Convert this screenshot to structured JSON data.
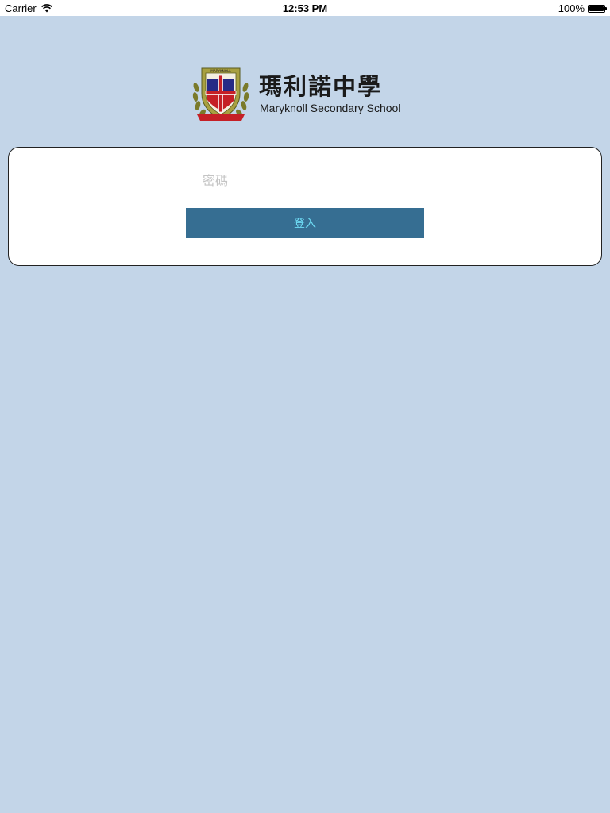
{
  "status_bar": {
    "carrier": "Carrier",
    "time": "12:53 PM",
    "battery": "100%",
    "icons": [
      "wifi-icon",
      "battery-icon"
    ]
  },
  "header": {
    "school_name_zh": "瑪利諾中學",
    "school_name_en": "Maryknoll Secondary School",
    "crest_motto": "MARYKNOLL",
    "logo_icon": "school-crest-icon"
  },
  "login": {
    "password_placeholder": "密碼",
    "password_value": "",
    "login_label": "登入"
  },
  "colors": {
    "background": "#c3d5e8",
    "button": "#366e92",
    "button_text": "#6fdcf5"
  }
}
